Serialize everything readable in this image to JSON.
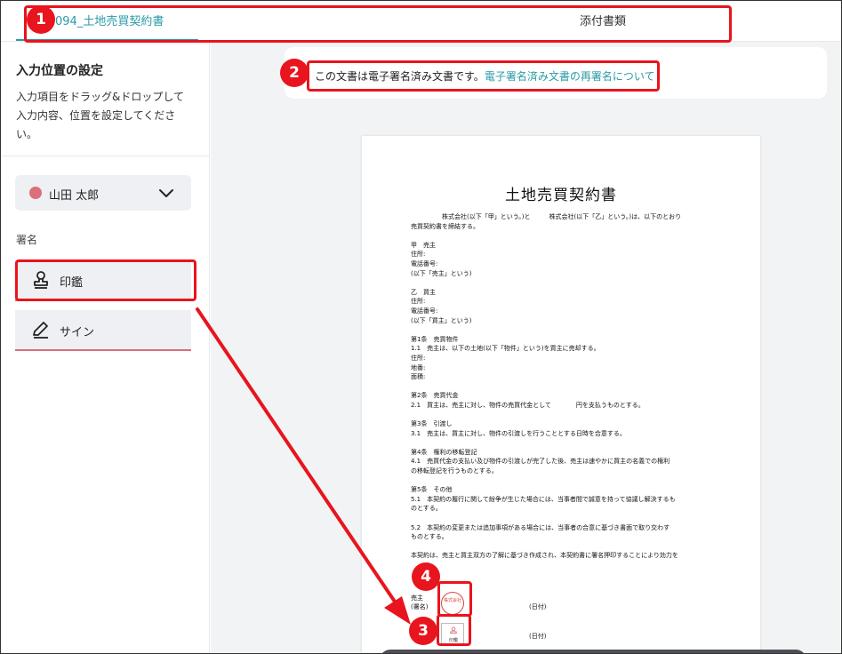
{
  "tabs": {
    "document": "094_土地売買契約書",
    "attachments": "添付書類"
  },
  "sidebar": {
    "title": "入力位置の設定",
    "description": "入力項目をドラッグ&ドロップして入力内容、位置を設定してください。",
    "signer_name": "山田 太郎",
    "signer_color": "#d9707a",
    "section_label": "署名",
    "fields": {
      "inkan": "印鑑",
      "sign": "サイン"
    }
  },
  "notice": {
    "text": "この文書は電子署名済み文書です。",
    "link": "電子署名済み文書の再署名について"
  },
  "document": {
    "title": "土地売買契約書",
    "intro": [
      "株式会社(以下「甲」という。)と　　　株式会社(以下「乙」という。)は、以下のとおり",
      "売買契約書を締結する。"
    ],
    "party_a": [
      "甲　売主",
      "住所:",
      "電話番号:",
      "(以下「売主」という)"
    ],
    "party_b": [
      "乙　買主",
      "住所:",
      "電話番号:",
      "(以下「買主」という)"
    ],
    "article1": [
      "第1条　売買物件",
      "1.1　売主は、以下の土地(以下「物件」という)を買主に売却する。",
      "住所:",
      "地番:",
      "面積:"
    ],
    "article2": [
      "第2条　売買代金",
      "2.1　買主は、売主に対し、物件の売買代金として　　　　円を支払うものとする。"
    ],
    "article3": [
      "第3条　引渡し",
      "3.1　売主は、買主に対し、物件の引渡しを行うこととする日時を合意する。"
    ],
    "article4": [
      "第4条　権利の移転登記",
      "4.1　売買代金の支払い及び物件の引渡しが完了した後、売主は速やかに買主の名義での権利",
      "の移転登記を行うものとする。"
    ],
    "article5": [
      "第5条　その他",
      "5.1　本契約の履行に関して紛争が生じた場合には、当事者間で誠意を持って協議し解決するも",
      "のとする。"
    ],
    "article5_2": [
      "5.2　本契約の変更または追加事項がある場合には、当事者の合意に基づき書面で取り交わす",
      "ものとする。"
    ],
    "closing": "本契約は、売主と買主双方の了解に基づき作成され、本契約書に署名押印することにより効力を",
    "seller_label": "売主",
    "sign_label": "(署名)",
    "date_label": "(日付)",
    "stamp_text": "株式会社",
    "placed_inkan_label": "印鑑"
  },
  "annotations": {
    "badge1": "1",
    "badge2": "2",
    "badge3": "3",
    "badge4": "4",
    "color": "#e8141e"
  }
}
